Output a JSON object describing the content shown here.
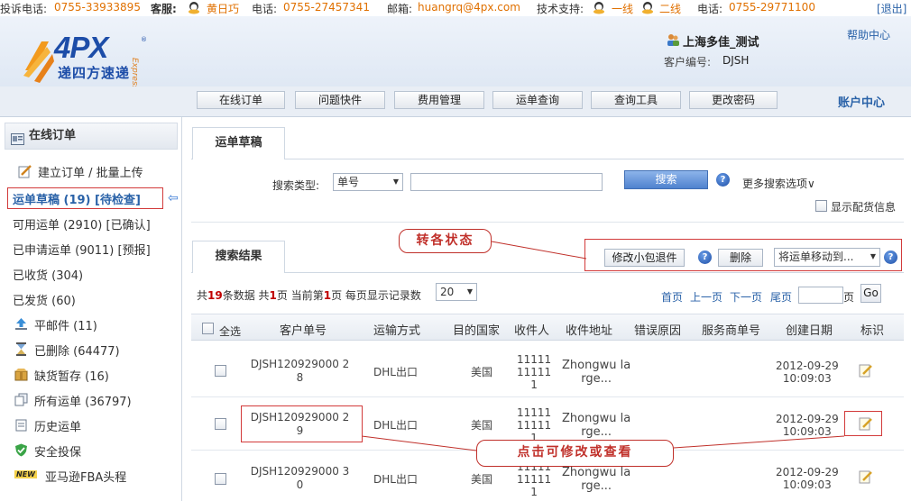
{
  "topbar": {
    "complaint_label": "投诉电话:",
    "complaint_phone": "0755-33933895",
    "service_label": "客服:",
    "service_name": "黄日巧",
    "phone_label": "电话:",
    "service_phone": "0755-27457341",
    "email_label": "邮箱:",
    "email": "huangrq@4px.com",
    "tech_label": "技术支持:",
    "line1": "一线",
    "line2": "二线",
    "phone_label2": "电话:",
    "tech_phone": "0755-29771100",
    "logout": "[退出]"
  },
  "header": {
    "logo_main": "4PX",
    "logo_sub": "递四方速递",
    "logo_express": "Express",
    "company": "上海多佳_测试",
    "customer_no_label": "客户编号:",
    "customer_no": "DJSH",
    "help": "帮助中心"
  },
  "nav": {
    "items": [
      "在线订单",
      "问题快件",
      "费用管理",
      "运单查询",
      "查询工具",
      "更改密码"
    ],
    "account": "账户中心"
  },
  "sidebar": {
    "title": "在线订单",
    "create": "建立订单 / 批量上传",
    "draft": "运单草稿 (19) [待检查]",
    "available": "可用运单 (2910) [已确认]",
    "applied": "已申请运单 (9011) [预报]",
    "received": "已收货 (304)",
    "shipped": "已发货 (60)",
    "flat": "平邮件 (11)",
    "deleted": "已删除 (64477)",
    "stockout": "缺货暂存 (16)",
    "all": "所有运单 (36797)",
    "history": "历史运单",
    "insurance": "安全投保",
    "fba_badge": "NEW",
    "fba": "亚马逊FBA头程"
  },
  "search": {
    "tab": "运单草稿",
    "type_label": "搜索类型:",
    "type_value": "单号",
    "search_value": "",
    "search_button": "搜索",
    "more": "更多搜索选项",
    "show_alloc": "显示配货信息"
  },
  "results": {
    "tab": "搜索结果",
    "edit_parcel": "修改小包退件",
    "delete": "删除",
    "move_to": "将运单移动到...",
    "summary_pre": "共",
    "total": "19",
    "summary_mid1": "条数据 共",
    "pages": "1",
    "summary_mid2": "页 当前第",
    "current": "1",
    "summary_mid3": "页 每页显示记录数",
    "per_page": "20",
    "first": "首页",
    "prev": "上一页",
    "next": "下一页",
    "last": "尾页",
    "page_input": "",
    "page_suffix": "页",
    "go": "Go",
    "columns": [
      "全选",
      "客户单号",
      "运输方式",
      "目的国家",
      "收件人",
      "收件地址",
      "错误原因",
      "服务商单号",
      "创建日期",
      "标识"
    ],
    "rows": [
      {
        "order_l1": "DJSH120929000 2",
        "order_l2": "8",
        "method": "DHL出口",
        "country": "美国",
        "recv_l1": "11111",
        "recv_l2": "11111",
        "recv_l3": "1",
        "addr_l1": "Zhongwu la",
        "addr_l2": "rge...",
        "date": "2012-09-29",
        "time": "10:09:03"
      },
      {
        "order_l1": "DJSH120929000 2",
        "order_l2": "9",
        "method": "DHL出口",
        "country": "美国",
        "recv_l1": "11111",
        "recv_l2": "11111",
        "recv_l3": "1",
        "addr_l1": "Zhongwu la",
        "addr_l2": "rge...",
        "date": "2012-09-29",
        "time": "10:09:03"
      },
      {
        "order_l1": "DJSH120929000 3",
        "order_l2": "0",
        "method": "DHL出口",
        "country": "美国",
        "recv_l1": "11111",
        "recv_l2": "11111",
        "recv_l3": "1",
        "addr_l1": "Zhongwu la",
        "addr_l2": "rge...",
        "date": "2012-09-29",
        "time": "10:09:03"
      }
    ]
  },
  "annotations": {
    "status": "转各状态",
    "edit": "点击可修改或查看"
  }
}
